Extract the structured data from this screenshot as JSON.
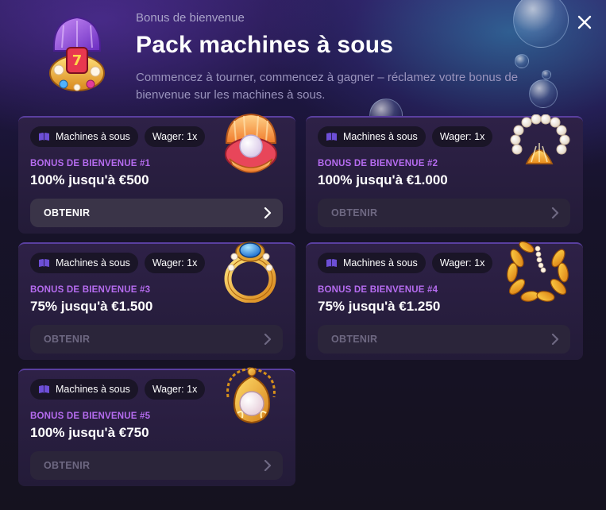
{
  "header": {
    "eyebrow": "Bonus de bienvenue",
    "title": "Pack machines à sous",
    "subtitle": "Commencez à tourner, commencez à gagner – réclamez votre bonus de bienvenue sur les machines à sous.",
    "close_icon": "close-icon",
    "logo_icon": "treasure-shell-icon"
  },
  "colors": {
    "accent": "#b66cf0",
    "card_bg": "#2e2147",
    "page_bg": "#15121f"
  },
  "cards": [
    {
      "category": "Machines à sous",
      "wager": "Wager: 1x",
      "label": "BONUS DE BIENVENUE #1",
      "offer": "100% jusqu'à €500",
      "claim": "OBTENIR",
      "claim_enabled": true,
      "art": "pearl-shell-icon"
    },
    {
      "category": "Machines à sous",
      "wager": "Wager: 1x",
      "label": "BONUS DE BIENVENUE #2",
      "offer": "100% jusqu'à €1.000",
      "claim": "OBTENIR",
      "claim_enabled": false,
      "art": "pearl-necklace-icon"
    },
    {
      "category": "Machines à sous",
      "wager": "Wager: 1x",
      "label": "BONUS DE BIENVENUE #3",
      "offer": "75% jusqu'à €1.500",
      "claim": "OBTENIR",
      "claim_enabled": false,
      "art": "sapphire-ring-icon"
    },
    {
      "category": "Machines à sous",
      "wager": "Wager: 1x",
      "label": "BONUS DE BIENVENUE #4",
      "offer": "75% jusqu'à €1.250",
      "claim": "OBTENIR",
      "claim_enabled": false,
      "art": "golden-wreath-icon"
    },
    {
      "category": "Machines à sous",
      "wager": "Wager: 1x",
      "label": "BONUS DE BIENVENUE #5",
      "offer": "100% jusqu'à €750",
      "claim": "OBTENIR",
      "claim_enabled": false,
      "art": "pearl-pendant-icon"
    }
  ]
}
